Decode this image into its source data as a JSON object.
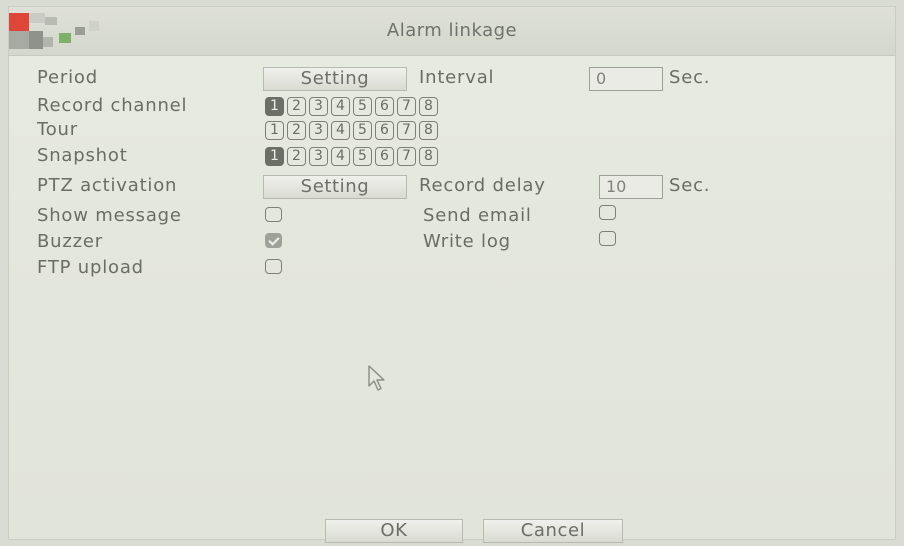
{
  "window": {
    "title": "Alarm linkage"
  },
  "form": {
    "period_label": "Period",
    "period_button": "Setting",
    "interval_label": "Interval",
    "interval_value": "0",
    "interval_unit": "Sec.",
    "record_channel_label": "Record channel",
    "record_channels": [
      {
        "num": "1",
        "checked": true
      },
      {
        "num": "2",
        "checked": false
      },
      {
        "num": "3",
        "checked": false
      },
      {
        "num": "4",
        "checked": false
      },
      {
        "num": "5",
        "checked": false
      },
      {
        "num": "6",
        "checked": false
      },
      {
        "num": "7",
        "checked": false
      },
      {
        "num": "8",
        "checked": false
      }
    ],
    "tour_label": "Tour",
    "tour_channels": [
      {
        "num": "1",
        "checked": false
      },
      {
        "num": "2",
        "checked": false
      },
      {
        "num": "3",
        "checked": false
      },
      {
        "num": "4",
        "checked": false
      },
      {
        "num": "5",
        "checked": false
      },
      {
        "num": "6",
        "checked": false
      },
      {
        "num": "7",
        "checked": false
      },
      {
        "num": "8",
        "checked": false
      }
    ],
    "snapshot_label": "Snapshot",
    "snapshot_channels": [
      {
        "num": "1",
        "checked": true
      },
      {
        "num": "2",
        "checked": false
      },
      {
        "num": "3",
        "checked": false
      },
      {
        "num": "4",
        "checked": false
      },
      {
        "num": "5",
        "checked": false
      },
      {
        "num": "6",
        "checked": false
      },
      {
        "num": "7",
        "checked": false
      },
      {
        "num": "8",
        "checked": false
      }
    ],
    "ptz_label": "PTZ activation",
    "ptz_button": "Setting",
    "record_delay_label": "Record delay",
    "record_delay_value": "10",
    "record_delay_unit": "Sec.",
    "show_message_label": "Show message",
    "show_message_checked": false,
    "send_email_label": "Send email",
    "send_email_checked": false,
    "buzzer_label": "Buzzer",
    "buzzer_checked": true,
    "write_log_label": "Write log",
    "write_log_checked": false,
    "ftp_upload_label": "FTP upload",
    "ftp_upload_checked": false
  },
  "footer": {
    "ok_label": "OK",
    "cancel_label": "Cancel"
  },
  "colors": {
    "logo_red": "#e0453a",
    "logo_green": "#7fb06a",
    "logo_gray": "#9a9c96"
  }
}
